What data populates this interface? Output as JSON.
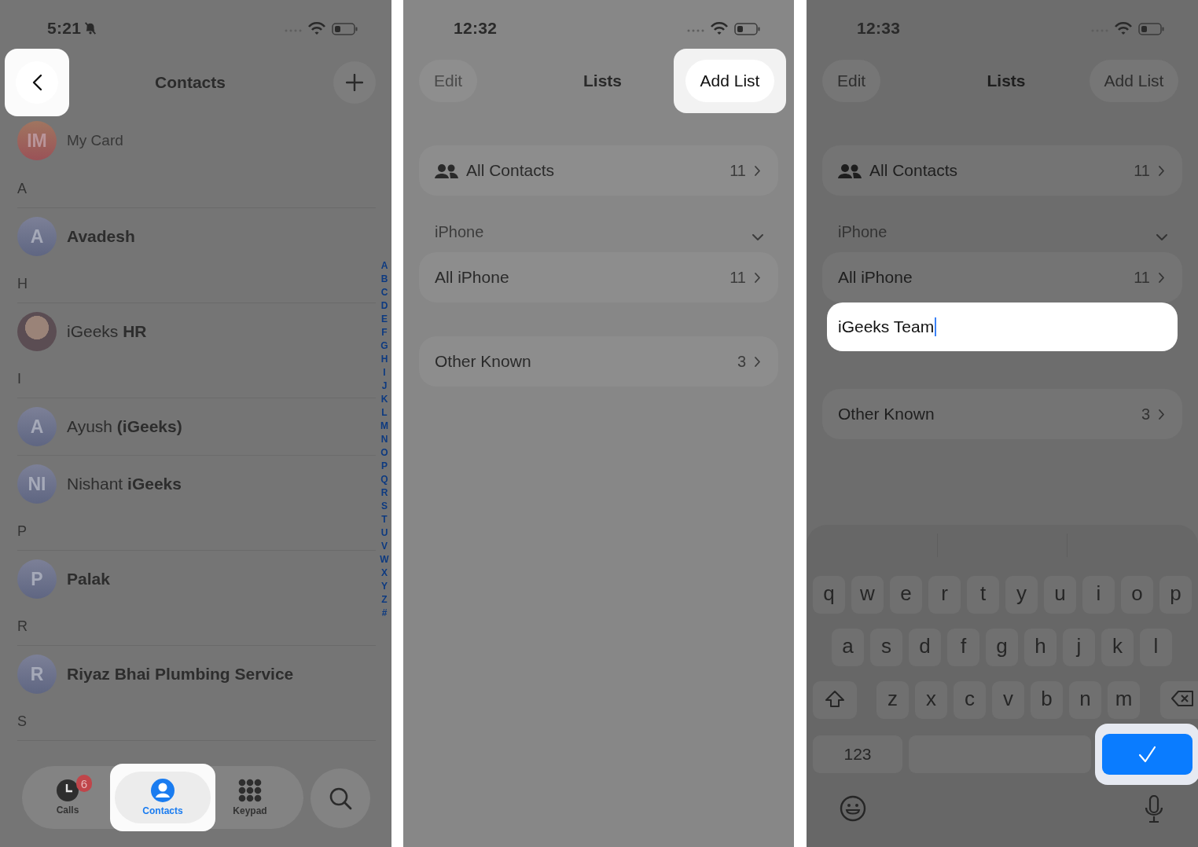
{
  "panels": [
    {
      "kind": "contacts",
      "status_bar": {
        "time": "5:21",
        "silent": true
      },
      "back_button": {
        "highlighted": true
      },
      "title": "Contacts",
      "add_button": {
        "highlighted": false
      },
      "my_card": {
        "initials": "IM",
        "label": "My Card"
      },
      "sections": [
        {
          "letter": "A",
          "contacts": [
            {
              "kind": "initials",
              "initials": "A",
              "name": "Avadesh",
              "bold": true
            }
          ]
        },
        {
          "letter": "H",
          "contacts": [
            {
              "kind": "photo",
              "name": "iGeeks **HR**",
              "bold": false
            }
          ]
        },
        {
          "letter": "I",
          "contacts": [
            {
              "kind": "initials",
              "initials": "A",
              "name": "Ayush **(iGeeks)**",
              "bold": false
            },
            {
              "kind": "initials",
              "initials": "NI",
              "name": "Nishant **iGeeks**",
              "bold": false
            }
          ]
        },
        {
          "letter": "P",
          "contacts": [
            {
              "kind": "initials",
              "initials": "P",
              "name": "Palak",
              "bold": true
            }
          ]
        },
        {
          "letter": "R",
          "contacts": [
            {
              "kind": "initials",
              "initials": "R",
              "name": "Riyaz Bhai Plumbing Service",
              "bold": true
            }
          ]
        },
        {
          "letter": "S"
        }
      ],
      "index": [
        "A",
        "B",
        "C",
        "D",
        "E",
        "F",
        "G",
        "H",
        "I",
        "J",
        "K",
        "L",
        "M",
        "N",
        "O",
        "P",
        "Q",
        "R",
        "S",
        "T",
        "U",
        "V",
        "W",
        "X",
        "Y",
        "Z",
        "#"
      ],
      "tab_bar": {
        "tabs": [
          {
            "kind": "clock",
            "label": "Calls",
            "badge": "6",
            "selected": false,
            "highlighted": false
          },
          {
            "kind": "person",
            "label": "Contacts",
            "selected": true,
            "highlighted": true
          },
          {
            "kind": "grid",
            "label": "Keypad",
            "selected": false,
            "highlighted": false
          }
        ]
      }
    },
    {
      "kind": "lists",
      "status_bar": {
        "time": "12:32",
        "silent": false
      },
      "edit_button": {
        "label": "Edit"
      },
      "title": "Lists",
      "add_list_button": {
        "label": "Add List",
        "highlighted": true
      },
      "all_contacts": {
        "label": "All Contacts",
        "count": "11"
      },
      "groups": [
        {
          "header": "iPhone",
          "expanded": true,
          "lists": [
            {
              "label": "All iPhone",
              "count": "11"
            }
          ]
        }
      ],
      "other": {
        "label": "Other Known",
        "count": "3"
      }
    },
    {
      "kind": "lists",
      "status_bar": {
        "time": "12:33",
        "silent": false
      },
      "edit_button": {
        "label": "Edit"
      },
      "title": "Lists",
      "add_list_button": {
        "label": "Add List",
        "highlighted": false
      },
      "all_contacts": {
        "label": "All Contacts",
        "count": "11"
      },
      "groups": [
        {
          "header": "iPhone",
          "expanded": true,
          "lists": [
            {
              "label": "All iPhone",
              "count": "11"
            }
          ]
        }
      ],
      "new_list_field": {
        "value": "iGeeks Team"
      },
      "other": {
        "label": "Other Known",
        "count": "3"
      },
      "keyboard": {
        "rows": [
          [
            "q",
            "w",
            "e",
            "r",
            "t",
            "y",
            "u",
            "i",
            "o",
            "p"
          ],
          [
            "a",
            "s",
            "d",
            "f",
            "g",
            "h",
            "j",
            "k",
            "l"
          ],
          [
            "z",
            "x",
            "c",
            "v",
            "b",
            "n",
            "m"
          ]
        ],
        "numbers_key": "123",
        "done_key": {
          "highlighted": true
        }
      }
    }
  ]
}
